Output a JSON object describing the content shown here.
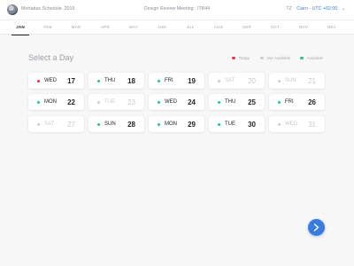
{
  "header": {
    "host_name": "Mortadas Schedule, 2019",
    "meeting_title": "Design Review Meeting : ITB44",
    "timezone_label": "TZ",
    "timezone_value": "Cairo - UTC +02:00",
    "avatar_icon": "user-avatar",
    "chevron_icon": "chevron-down-icon"
  },
  "months": [
    {
      "label": "JAN",
      "active": true
    },
    {
      "label": "FEB",
      "active": false
    },
    {
      "label": "MAR",
      "active": false
    },
    {
      "label": "APR",
      "active": false
    },
    {
      "label": "MAY",
      "active": false
    },
    {
      "label": "JUN",
      "active": false
    },
    {
      "label": "JUL",
      "active": false
    },
    {
      "label": "AUG",
      "active": false
    },
    {
      "label": "SEP",
      "active": false
    },
    {
      "label": "OCT",
      "active": false
    },
    {
      "label": "NOV",
      "active": false
    },
    {
      "label": "DEC",
      "active": false
    }
  ],
  "section_title": "Select a Day",
  "legend": [
    {
      "label": "Today",
      "color": "#e0354f"
    },
    {
      "label": "Not Available",
      "color": "#c9cbcf"
    },
    {
      "label": "Available",
      "color": "#2fc07a"
    }
  ],
  "days": [
    {
      "name": "WED",
      "num": "17",
      "status": "today"
    },
    {
      "name": "THU",
      "num": "18",
      "status": "available"
    },
    {
      "name": "FRI",
      "num": "19",
      "status": "available"
    },
    {
      "name": "SAT",
      "num": "20",
      "status": "unavailable"
    },
    {
      "name": "SUN",
      "num": "21",
      "status": "unavailable"
    },
    {
      "name": "MON",
      "num": "22",
      "status": "available"
    },
    {
      "name": "TUE",
      "num": "23",
      "status": "unavailable"
    },
    {
      "name": "WED",
      "num": "24",
      "status": "available"
    },
    {
      "name": "THU",
      "num": "25",
      "status": "available"
    },
    {
      "name": "FRI",
      "num": "26",
      "status": "available"
    },
    {
      "name": "SAT",
      "num": "27",
      "status": "unavailable"
    },
    {
      "name": "SUN",
      "num": "28",
      "status": "available"
    },
    {
      "name": "MON",
      "num": "29",
      "status": "available"
    },
    {
      "name": "TUE",
      "num": "30",
      "status": "available"
    },
    {
      "name": "WED",
      "num": "31",
      "status": "unavailable"
    }
  ],
  "status_colors": {
    "today": "#e0354f",
    "available": "#2fc07a",
    "unavailable": "#c9cbcf"
  },
  "next_button": {
    "icon": "chevron-right-icon",
    "color": "#3b7be0"
  }
}
